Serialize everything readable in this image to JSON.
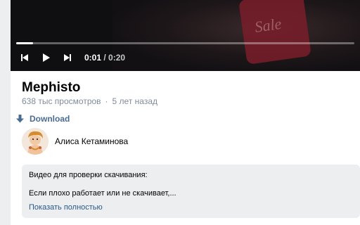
{
  "player": {
    "progress": 0.05,
    "time_current": "0:01",
    "time_sep": " / ",
    "time_total": "0:20",
    "frame_text": "Sale"
  },
  "video": {
    "title": "Mephisto",
    "views": "638 тыс просмотров",
    "dot": "·",
    "age": "5 лет назад"
  },
  "download": {
    "label": "Download"
  },
  "author": {
    "name": "Алиса Кетаминова"
  },
  "description": {
    "line1": "Видео для проверки скачивания:",
    "line2": "Если плохо работает или не скачивает,...",
    "show_more": "Показать полностью"
  },
  "colors": {
    "link": "#2a5885",
    "muted": "#818c99",
    "download": "#4a6c93"
  }
}
